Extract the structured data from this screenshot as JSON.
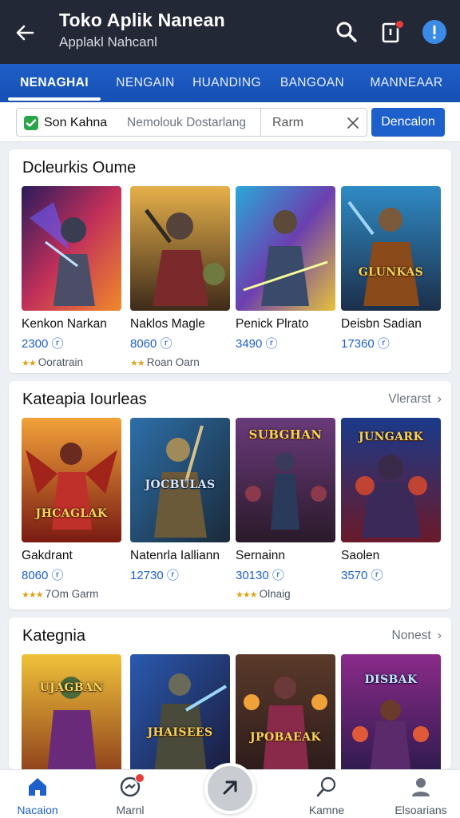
{
  "appbar": {
    "title": "Toko Aplik Nanean",
    "subtitle": "Applakl Nahcanl"
  },
  "tabs": [
    {
      "label": "NENAGHAI",
      "active": true
    },
    {
      "label": "NENGAIN",
      "active": false
    },
    {
      "label": "HUANDING",
      "active": false
    },
    {
      "label": "BANGOAN",
      "active": false
    },
    {
      "label": "MANNEAAR",
      "active": false
    }
  ],
  "filter": {
    "chip_label": "Son Kahna",
    "chip_placeholder": "Nemolouk Dostarlang",
    "search_value": "Rarm",
    "button_label": "Dencalon"
  },
  "sections": [
    {
      "title": "Dcleurkis Oume",
      "see_more": "",
      "items": [
        {
          "name": "Kenkon Narkan",
          "price": "2300",
          "rating": "Ooratrain",
          "stars": 2
        },
        {
          "name": "Naklos Magle",
          "price": "8060",
          "rating": "Roan Oarn",
          "stars": 2
        },
        {
          "name": "Penick Plrato",
          "price": "3490",
          "rating": "",
          "stars": 0
        },
        {
          "name": "Deisbn Sadian",
          "price": "17360",
          "rating": "",
          "stars": 0
        }
      ]
    },
    {
      "title": "Kateapia Iourleas",
      "see_more": "Vlerarst",
      "items": [
        {
          "name": "Gakdrant",
          "price": "8060",
          "rating": "7Om Garm",
          "stars": 3
        },
        {
          "name": "Natenrla Ialliann",
          "price": "12730",
          "rating": "",
          "stars": 0
        },
        {
          "name": "Sernainn",
          "price": "30130",
          "rating": "Olnaig",
          "stars": 3
        },
        {
          "name": "Saolen",
          "price": "3570",
          "rating": "",
          "stars": 0
        }
      ]
    },
    {
      "title": "Kategnia",
      "see_more": "Nonest",
      "items": [
        {
          "name": "",
          "price": "",
          "rating": "",
          "stars": 0
        },
        {
          "name": "",
          "price": "",
          "rating": "",
          "stars": 0
        },
        {
          "name": "",
          "price": "",
          "rating": "",
          "stars": 0
        },
        {
          "name": "",
          "price": "",
          "rating": "",
          "stars": 0
        }
      ]
    }
  ],
  "thumb_logos": {
    "s1_3": "GLUNKAS",
    "s2_1": "JHCAGLAK",
    "s2_2": "JOCBULAS",
    "s2_3": "SUBGHAN",
    "s2_4": "JUNGARK",
    "s3_1": "UJAGBAN",
    "s3_2": "JHAISEES",
    "s3_3": "JPOBAEAK",
    "s3_4": "DISBAK"
  },
  "bottom_nav": [
    {
      "label": "Nacaion",
      "icon": "home-icon",
      "active": true
    },
    {
      "label": "Marnl",
      "icon": "chat-icon",
      "active": false,
      "badge": true
    },
    {
      "label": "",
      "icon": "play-icon",
      "active": false
    },
    {
      "label": "Kamne",
      "icon": "search-icon",
      "active": false
    },
    {
      "label": "Elsoarians",
      "icon": "user-icon",
      "active": false
    }
  ],
  "colors": {
    "appbar": "#232836",
    "tabs": "#1d5fcb",
    "accent": "#1d5fcb",
    "check": "#2aa549",
    "badge": "#e83b3b"
  }
}
